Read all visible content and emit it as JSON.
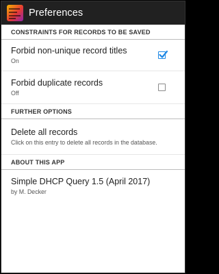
{
  "app_bar": {
    "title": "Preferences",
    "icon": "app-logo-icon"
  },
  "sections": {
    "constraints": {
      "header": "CONSTRAINTS FOR RECORDS TO BE SAVED",
      "forbid_non_unique": {
        "title": "Forbid non-unique record titles",
        "summary": "On",
        "checked": true
      },
      "forbid_duplicate": {
        "title": "Forbid duplicate records",
        "summary": "Off",
        "checked": false
      }
    },
    "further": {
      "header": "FURTHER OPTIONS",
      "delete_all": {
        "title": "Delete all records",
        "summary": "Click on this entry to delete all records in the database."
      }
    },
    "about": {
      "header": "ABOUT THIS APP",
      "app_info": {
        "title": "Simple DHCP Query 1.5 (April 2017)",
        "summary": "by M. Decker"
      }
    }
  },
  "colors": {
    "action_bar": "#212121",
    "checkbox_accent": "#1e88e5",
    "background": "#ffffff"
  }
}
